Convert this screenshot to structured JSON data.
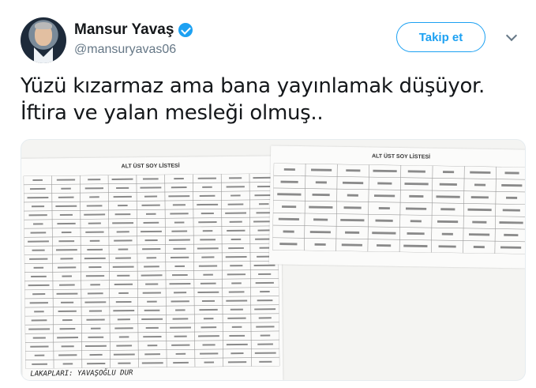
{
  "author": {
    "display_name": "Mansur Yavaş",
    "handle": "@mansuryavas06",
    "verified_icon": "verified-badge-icon"
  },
  "actions": {
    "follow_label": "Takip et",
    "more_icon": "chevron-down-icon"
  },
  "tweet": {
    "lines": [
      "Yüzü kızarmaz ama bana yayınlamak düşüyor.",
      "İftira ve yalan mesleği olmuş.."
    ]
  },
  "media": {
    "left_doc_title": "ALT ÜST SOY LİSTESİ",
    "right_doc_title": "ALT ÜST SOY LİSTESİ",
    "handwritten_note": "LAKAPLARI: YAVAŞOĞLU DUR"
  },
  "colors": {
    "accent": "#1da1f2",
    "text": "#14171a",
    "secondary": "#657786"
  }
}
